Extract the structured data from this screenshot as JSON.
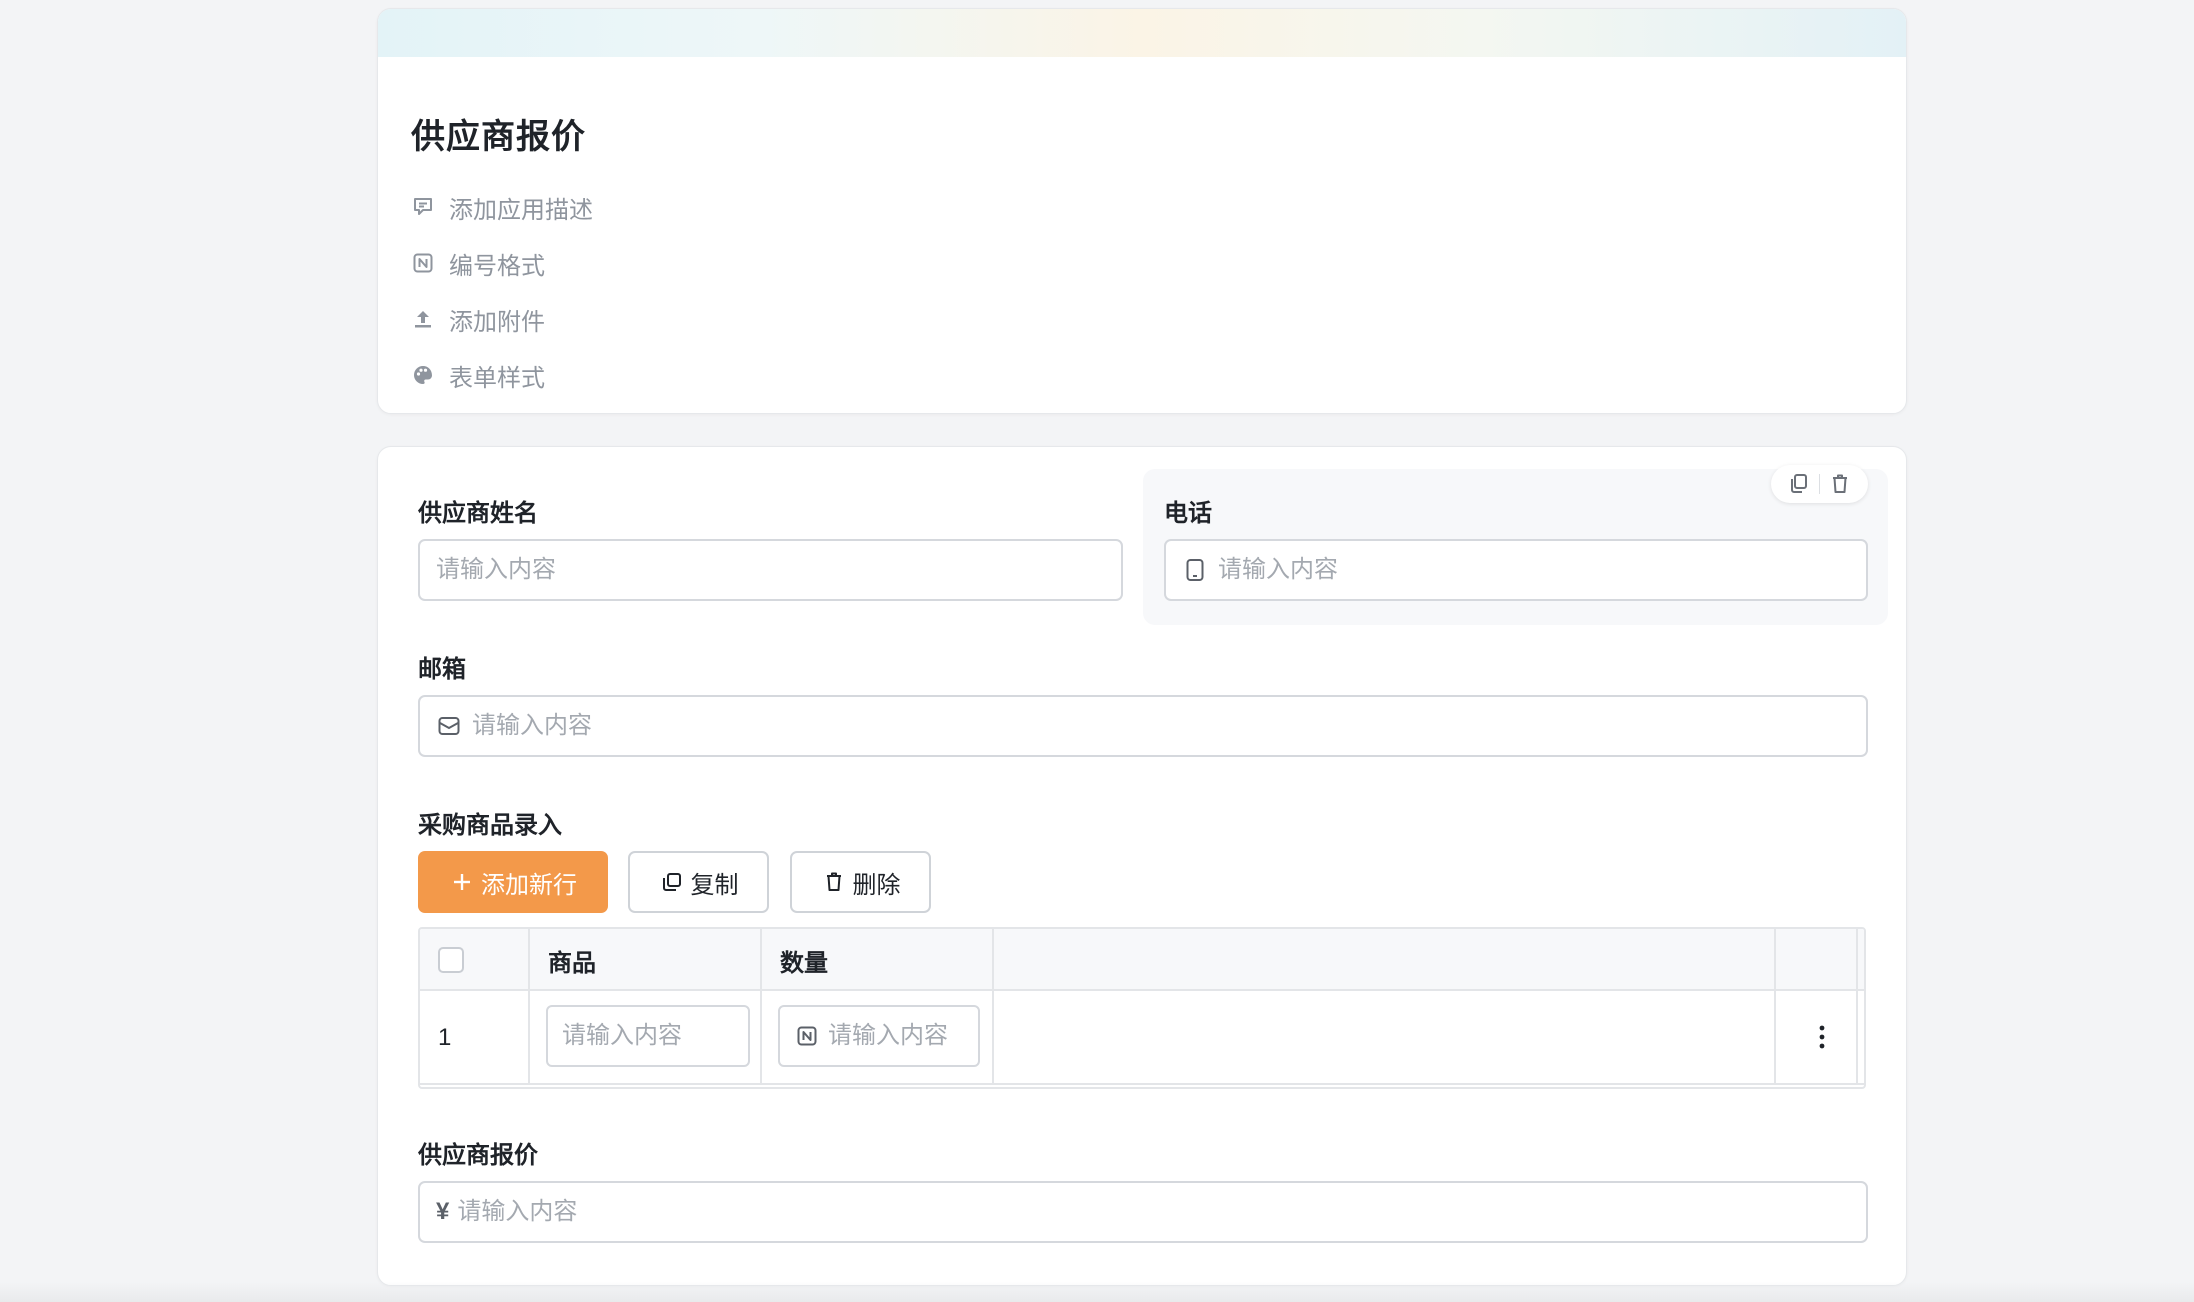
{
  "header": {
    "title": "供应商报价",
    "meta_items": [
      {
        "icon": "comment-icon",
        "label": "添加应用描述"
      },
      {
        "icon": "number-format-icon",
        "label": "编号格式"
      },
      {
        "icon": "upload-icon",
        "label": "添加附件"
      },
      {
        "icon": "palette-icon",
        "label": "表单样式"
      }
    ]
  },
  "form": {
    "supplier_name": {
      "label": "供应商姓名",
      "placeholder": "请输入内容",
      "value": ""
    },
    "phone": {
      "label": "电话",
      "placeholder": "请输入内容",
      "value": "",
      "icon": "phone-icon"
    },
    "email": {
      "label": "邮箱",
      "placeholder": "请输入内容",
      "value": "",
      "icon": "mail-icon"
    },
    "purchase_items": {
      "label": "采购商品录入",
      "add_row_label": "添加新行",
      "copy_label": "复制",
      "delete_label": "删除",
      "columns": [
        "商品",
        "数量"
      ],
      "rows": [
        {
          "index": "1",
          "product_placeholder": "请输入内容",
          "quantity_placeholder": "请输入内容"
        }
      ]
    },
    "quote": {
      "label": "供应商报价",
      "placeholder": "请输入内容",
      "prefix": "¥",
      "value": ""
    }
  },
  "colors": {
    "primary": "#f3994a",
    "text": "#1f2329",
    "muted": "#8f959e",
    "placeholder": "#a4a9b0",
    "border": "#d5d8dd"
  }
}
